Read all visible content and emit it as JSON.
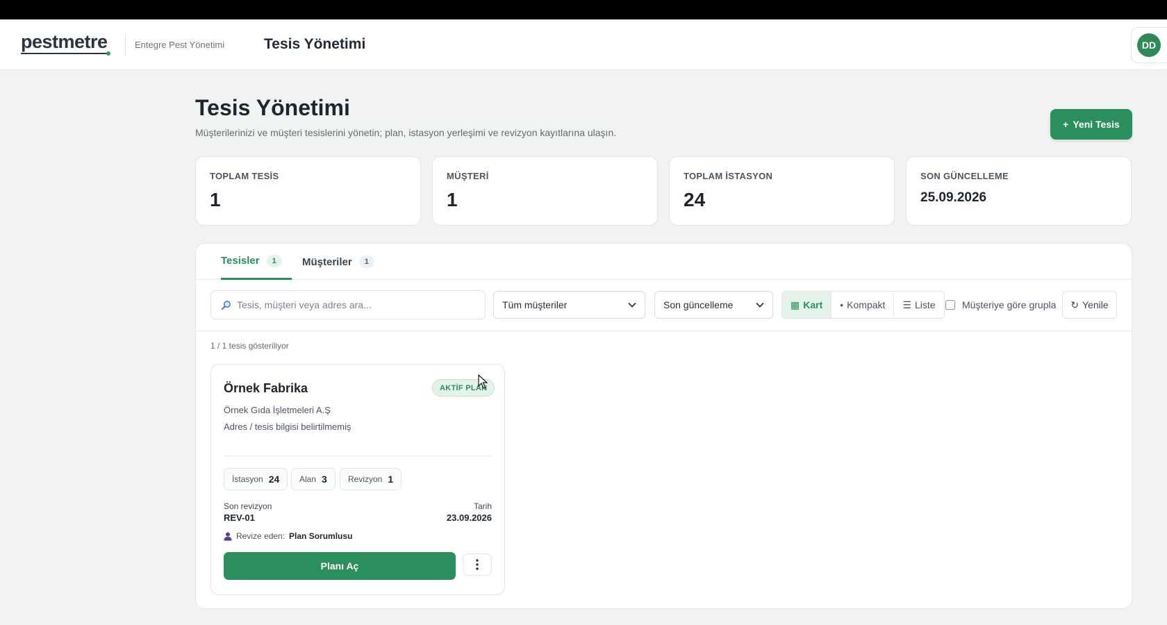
{
  "header": {
    "logo": "pestmetre",
    "subtitle": "Entegre Pest Yönetimi",
    "title": "Tesis Yönetimi",
    "avatar_initials": "DD"
  },
  "page": {
    "title": "Tesis Yönetimi",
    "description": "Müşterilerinizi ve müşteri tesislerini yönetin; plan, istasyon yerleşimi ve revizyon kayıtlarına ulaşın.",
    "new_button_icon": "+",
    "new_button_label": "Yeni Tesis"
  },
  "stats": [
    {
      "label": "TOPLAM TESİS",
      "value": "1"
    },
    {
      "label": "MÜŞTERİ",
      "value": "1"
    },
    {
      "label": "TOPLAM İSTASYON",
      "value": "24"
    },
    {
      "label": "SON GÜNCELLEME",
      "value": "25.09.2026"
    }
  ],
  "tabs": [
    {
      "label": "Tesisler",
      "count": "1",
      "active": true
    },
    {
      "label": "Müşteriler",
      "count": "1",
      "active": false
    }
  ],
  "toolbar": {
    "search_placeholder": "Tesis, müşteri veya adres ara...",
    "customer_filter": "Tüm müşteriler",
    "sort": "Son güncelleme",
    "views": [
      {
        "icon": "▦",
        "label": "Kart",
        "active": true
      },
      {
        "icon": "•",
        "label": "Kompakt",
        "active": false
      },
      {
        "icon": "☰",
        "label": "Liste",
        "active": false
      }
    ],
    "group_label": "Müşteriye göre grupla",
    "refresh_icon": "↻",
    "refresh_label": "Yenile"
  },
  "results": {
    "count_text": "1 / 1 tesis gösteriliyor"
  },
  "facility": {
    "name": "Örnek Fabrika",
    "status": "AKTİF PLAN",
    "customer": "Örnek Gıda İşletmeleri A.Ş",
    "address": "Adres / tesis bilgisi belirtilmemiş",
    "chips": [
      {
        "label": "İstasyon",
        "value": "24"
      },
      {
        "label": "Alan",
        "value": "3"
      },
      {
        "label": "Revizyon",
        "value": "1"
      }
    ],
    "last_revision_label": "Son revizyon",
    "last_revision": "REV-01",
    "date_label": "Tarih",
    "date": "23.09.2026",
    "reviser_label": "Revize eden:",
    "reviser": "Plan Sorumlusu",
    "open_button": "Planı Aç"
  },
  "colors": {
    "brand": "#2a8f5c",
    "brand_light": "#e3f3ea",
    "text_dark": "#1c2530"
  }
}
